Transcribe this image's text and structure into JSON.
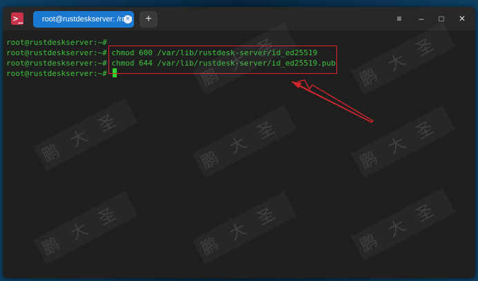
{
  "app": {
    "icon": "terminal-icon"
  },
  "tabs": [
    {
      "label": "root@rustdeskserver: /root",
      "active": true
    }
  ],
  "titlebar": {
    "new_tab_label": "+",
    "menu_glyph": "≡",
    "minimize_glyph": "–",
    "maximize_glyph": "□",
    "close_glyph": "✕"
  },
  "terminal": {
    "prompt": "root@rustdeskserver:~#",
    "lines": [
      {
        "prompt": "root@rustdeskserver:~#",
        "command": ""
      },
      {
        "prompt": "root@rustdeskserver:~#",
        "command": " chmod 600 /var/lib/rustdesk-server/id_ed25519"
      },
      {
        "prompt": "root@rustdeskserver:~#",
        "command": " chmod 644 /var/lib/rustdesk-server/id_ed25519.pub"
      },
      {
        "prompt": "root@rustdeskserver:~#",
        "command": " "
      }
    ]
  },
  "watermark": {
    "text": "鹏大圣"
  },
  "colors": {
    "terminal_text": "#3ec43e",
    "tab_active": "#1a78d2",
    "annotation": "#e0262c",
    "background": "#1f1f1f"
  }
}
